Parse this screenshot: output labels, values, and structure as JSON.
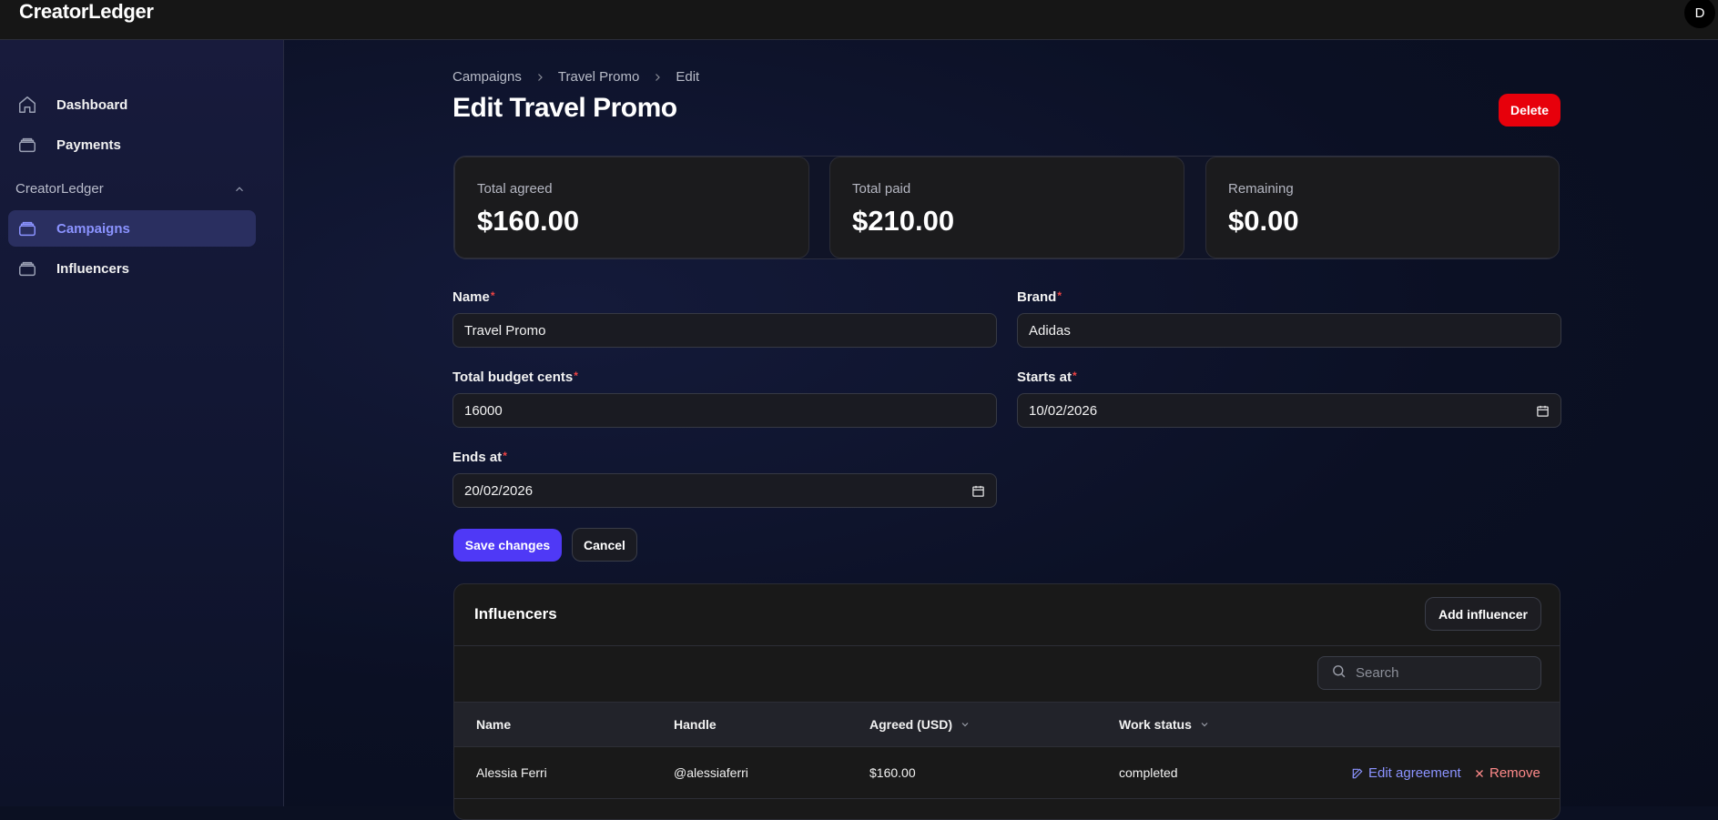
{
  "app": {
    "brand": "CreatorLedger",
    "avatar_initial": "D"
  },
  "sidebar": {
    "items": [
      {
        "label": "Dashboard",
        "icon": "home-icon"
      },
      {
        "label": "Payments",
        "icon": "stack-icon"
      }
    ],
    "group": {
      "label": "CreatorLedger",
      "items": [
        {
          "label": "Campaigns",
          "icon": "stack-icon",
          "active": true
        },
        {
          "label": "Influencers",
          "icon": "stack-icon"
        }
      ]
    }
  },
  "breadcrumb": [
    "Campaigns",
    "Travel Promo",
    "Edit"
  ],
  "page": {
    "title": "Edit Travel Promo",
    "delete_label": "Delete"
  },
  "stats": [
    {
      "label": "Total agreed",
      "value": "$160.00"
    },
    {
      "label": "Total paid",
      "value": "$210.00"
    },
    {
      "label": "Remaining",
      "value": "$0.00"
    }
  ],
  "form": {
    "name": {
      "label": "Name",
      "value": "Travel Promo"
    },
    "brand": {
      "label": "Brand",
      "value": "Adidas"
    },
    "budget": {
      "label": "Total budget cents",
      "value": "16000"
    },
    "starts_at": {
      "label": "Starts at",
      "value": "10/02/2026"
    },
    "ends_at": {
      "label": "Ends at",
      "value": "20/02/2026"
    },
    "required_mark": "*",
    "save_label": "Save changes",
    "cancel_label": "Cancel"
  },
  "influencers": {
    "title": "Influencers",
    "add_label": "Add influencer",
    "search_placeholder": "Search",
    "columns": [
      "Name",
      "Handle",
      "Agreed (USD)",
      "Work status"
    ],
    "rows": [
      {
        "name": "Alessia Ferri",
        "handle": "@alessiaferri",
        "agreed": "$160.00",
        "status": "completed",
        "edit_label": "Edit agreement",
        "remove_label": "Remove"
      }
    ]
  },
  "colors": {
    "accent": "#4f39f6",
    "danger": "#e7000b",
    "link": "#8b93ff"
  }
}
